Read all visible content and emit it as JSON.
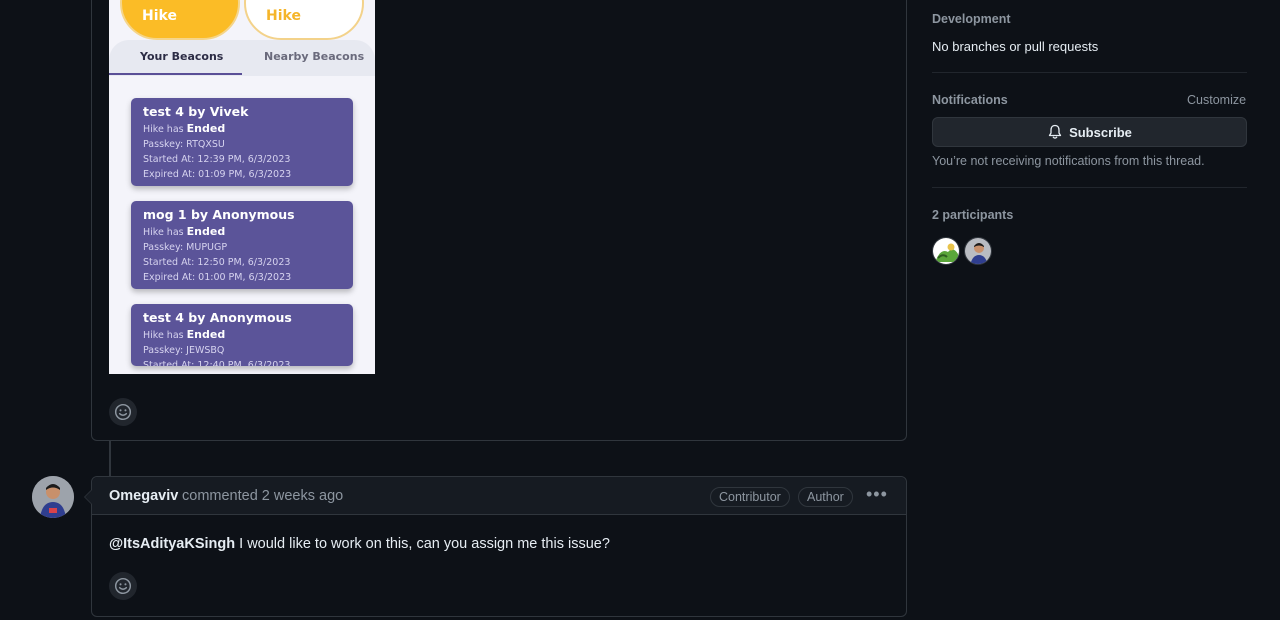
{
  "phone": {
    "pill_left": "Hike",
    "pill_right": "Hike",
    "tab_your": "Your Beacons",
    "tab_nearby": "Nearby Beacons",
    "beacons": [
      {
        "title": "test 4 by Vivek",
        "status_prefix": "Hike has",
        "status": "Ended",
        "passkey": "Passkey: RTQXSU",
        "started": "Started At: 12:39 PM, 6/3/2023",
        "expired": "Expired At: 01:09 PM, 6/3/2023"
      },
      {
        "title": "mog 1 by Anonymous",
        "status_prefix": "Hike has",
        "status": "Ended",
        "passkey": "Passkey: MUPUGP",
        "started": "Started At: 12:50 PM, 6/3/2023",
        "expired": "Expired At: 01:00 PM, 6/3/2023"
      },
      {
        "title": "test 4 by Anonymous",
        "status_prefix": "Hike has",
        "status": "Ended",
        "passkey": "Passkey: JEWSBQ",
        "started": "Started At: 12:40 PM, 6/3/2023",
        "expired": ""
      }
    ]
  },
  "comment": {
    "author": "Omegaviv",
    "action": "commented 2 weeks ago",
    "badges": [
      "Contributor",
      "Author"
    ],
    "more": "•••",
    "mention": "@ItsAdityaKSingh",
    "body": " I would like to work on this, can you assign me this issue?"
  },
  "sidebar": {
    "development_title": "Development",
    "development_text": "No branches or pull requests",
    "notifications_title": "Notifications",
    "customize": "Customize",
    "subscribe": "Subscribe",
    "notifications_note": "You’re not receiving notifications from this thread.",
    "participants_title": "2 participants"
  },
  "icons": {
    "emoji": "smiley-icon",
    "bell": "bell-icon"
  }
}
